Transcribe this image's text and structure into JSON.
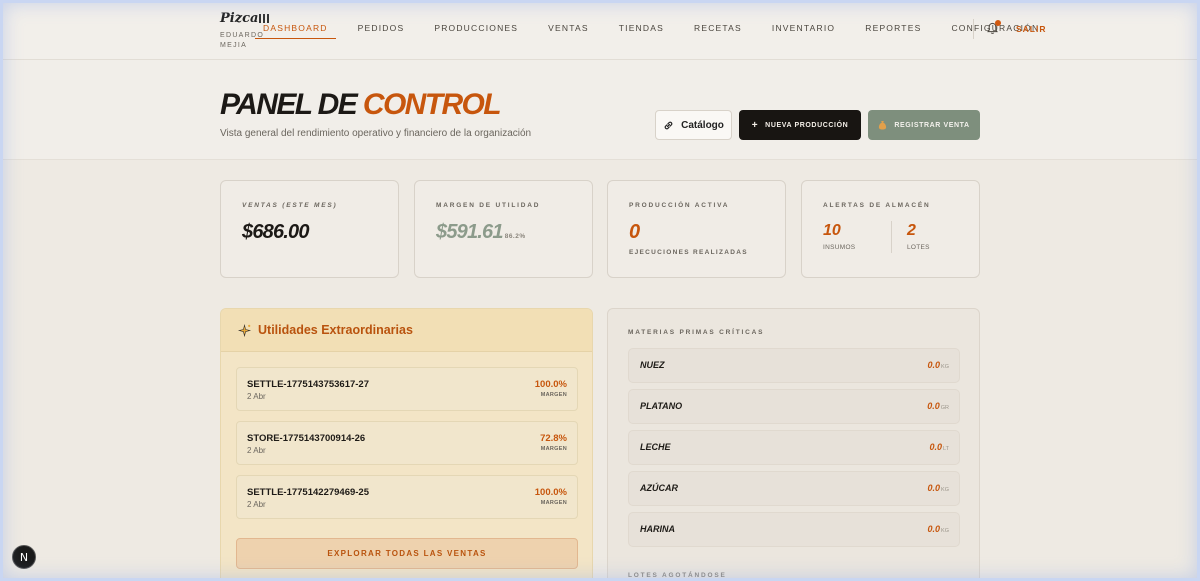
{
  "header": {
    "logo": "Pizca",
    "user": "EDUARDO MEJIA",
    "nav": [
      "DASHBOARD",
      "PEDIDOS",
      "PRODUCCIONES",
      "VENTAS",
      "TIENDAS",
      "RECETAS",
      "INVENTARIO",
      "REPORTES",
      "CONFIGURACIÓN"
    ],
    "active_nav": "DASHBOARD",
    "logout": "SALIR",
    "has_notification": true
  },
  "hero": {
    "title_part1": "PANEL DE",
    "title_part2": "CONTROL",
    "subtitle": "Vista general del rendimiento operativo y financiero de la organización",
    "btn_catalog": "Catálogo",
    "btn_new": "NUEVA PRODUCCIÓN",
    "btn_sale": "REGISTRAR VENTA"
  },
  "kpis": {
    "sales": {
      "label": "VENTAS (ESTE MES)",
      "value": "$686.00"
    },
    "margin": {
      "label": "MARGEN DE UTILIDAD",
      "value": "$591.61",
      "pct": "86.2%"
    },
    "production": {
      "label": "PRODUCCIÓN ACTIVA",
      "value": "0",
      "sub": "EJECUCIONES REALIZADAS"
    },
    "alerts": {
      "label": "ALERTAS DE ALMACÉN",
      "supplies": "10",
      "supplies_label": "INSUMOS",
      "lots": "2",
      "lots_label": "LOTES"
    }
  },
  "utilities": {
    "title": "Utilidades Extraordinarias",
    "rows": [
      {
        "name": "SETTLE-1775143753617-27",
        "date": "2 Abr",
        "pct": "100.0%",
        "pct_label": "MARGEN"
      },
      {
        "name": "STORE-1775143700914-26",
        "date": "2 Abr",
        "pct": "72.8%",
        "pct_label": "MARGEN"
      },
      {
        "name": "SETTLE-1775142279469-25",
        "date": "2 Abr",
        "pct": "100.0%",
        "pct_label": "MARGEN"
      }
    ],
    "cta": "EXPLORAR TODAS LAS VENTAS"
  },
  "materials": {
    "label": "MATERIAS PRIMAS CRÍTICAS",
    "rows": [
      {
        "name": "NUEZ",
        "value": "0.0",
        "unit": "KG"
      },
      {
        "name": "PLATANO",
        "value": "0.0",
        "unit": "GR"
      },
      {
        "name": "LECHE",
        "value": "0.0",
        "unit": "LT"
      },
      {
        "name": "AZÚCAR",
        "value": "0.0",
        "unit": "KG"
      },
      {
        "name": "HARINA",
        "value": "0.0",
        "unit": "KG"
      }
    ],
    "footer_label": "LOTES AGOTÁNDOSE"
  },
  "colors": {
    "accent": "#c7560d",
    "sage": "#7e8f7d",
    "dark": "#181512"
  },
  "badge": "N"
}
